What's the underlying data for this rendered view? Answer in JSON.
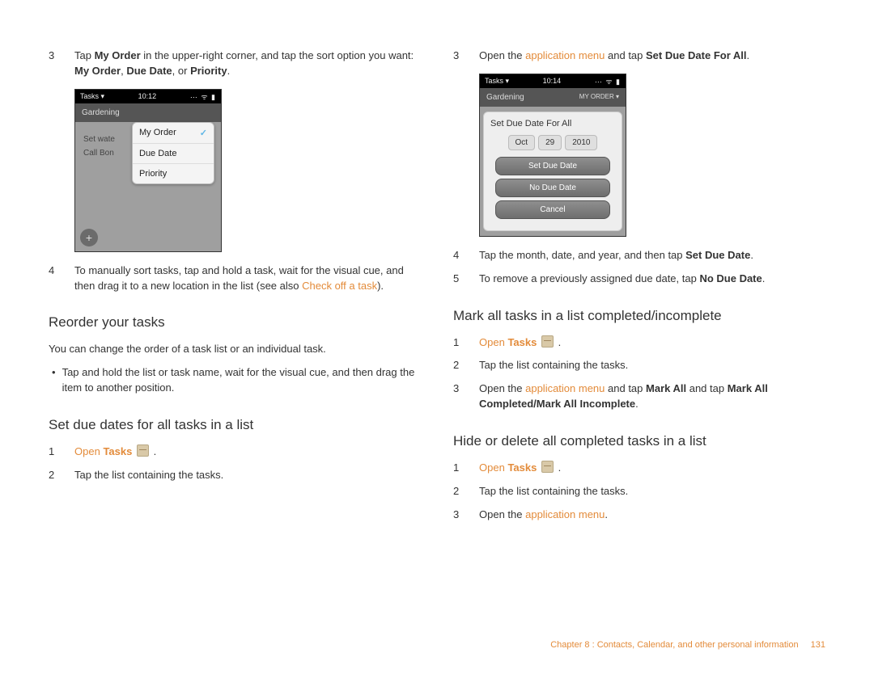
{
  "left": {
    "step3": {
      "num": "3",
      "t1": "Tap ",
      "b1": "My Order",
      "t2": " in the upper-right corner, and tap the sort option you want: ",
      "b2": "My Order",
      "t3": ", ",
      "b3": "Due Date",
      "t4": ", or ",
      "b4": "Priority",
      "t5": "."
    },
    "phone1": {
      "app": "Tasks ▾",
      "time": "10:12",
      "title": "Gardening",
      "row1": "Set wate",
      "row2": "Call Bon",
      "p1": "My Order",
      "p2": "Due Date",
      "p3": "Priority"
    },
    "step4": {
      "num": "4",
      "t1": "To manually sort tasks, tap and hold a task, wait for the visual cue, and then drag it to a new location in the list (see also ",
      "link": "Check off a task",
      "t2": ")."
    },
    "h_reorder": "Reorder your tasks",
    "reorder_intro": "You can change the order of a task list or an individual task.",
    "reorder_bullet": "Tap and hold the list or task name, wait for the visual cue, and then drag the item to another position.",
    "h_setdue": "Set due dates for all tasks in a list",
    "setdue_s1": {
      "num": "1",
      "link": "Open",
      "bold": "Tasks",
      "tail": " ."
    },
    "setdue_s2": {
      "num": "2",
      "text": "Tap the list containing the tasks."
    }
  },
  "right": {
    "step3": {
      "num": "3",
      "t1": "Open the ",
      "link": "application menu",
      "t2": " and tap ",
      "b1": "Set Due Date For All",
      "t3": "."
    },
    "phone2": {
      "app": "Tasks ▾",
      "time": "10:14",
      "title": "Gardening",
      "subtitle": "MY ORDER ▾",
      "sheet_title": "Set Due Date For All",
      "seg_m": "Oct",
      "seg_d": "29",
      "seg_y": "2010",
      "btn1": "Set Due Date",
      "btn2": "No Due Date",
      "btn3": "Cancel"
    },
    "step4": {
      "num": "4",
      "t1": "Tap the month, date, and year, and then tap ",
      "b1": "Set Due Date",
      "t2": "."
    },
    "step5": {
      "num": "5",
      "t1": "To remove a previously assigned due date, tap ",
      "b1": "No Due Date",
      "t2": "."
    },
    "h_mark": "Mark all tasks in a list completed/incomplete",
    "mark_s1": {
      "num": "1",
      "link": "Open",
      "bold": "Tasks",
      "tail": " ."
    },
    "mark_s2": {
      "num": "2",
      "text": "Tap the list containing the tasks."
    },
    "mark_s3": {
      "num": "3",
      "t1": "Open the ",
      "link": "application menu",
      "t2": " and tap ",
      "b1": "Mark All",
      "t3": " and tap ",
      "b2": "Mark All Completed/Mark All Incomplete",
      "t4": "."
    },
    "h_hide": "Hide or delete all completed tasks in a list",
    "hide_s1": {
      "num": "1",
      "link": "Open",
      "bold": "Tasks",
      "tail": " ."
    },
    "hide_s2": {
      "num": "2",
      "text": "Tap the list containing the tasks."
    },
    "hide_s3": {
      "num": "3",
      "t1": "Open the ",
      "link": "application menu",
      "t2": "."
    }
  },
  "footer": {
    "chapter": "Chapter 8 : Contacts, Calendar, and other personal information",
    "page": "131"
  }
}
